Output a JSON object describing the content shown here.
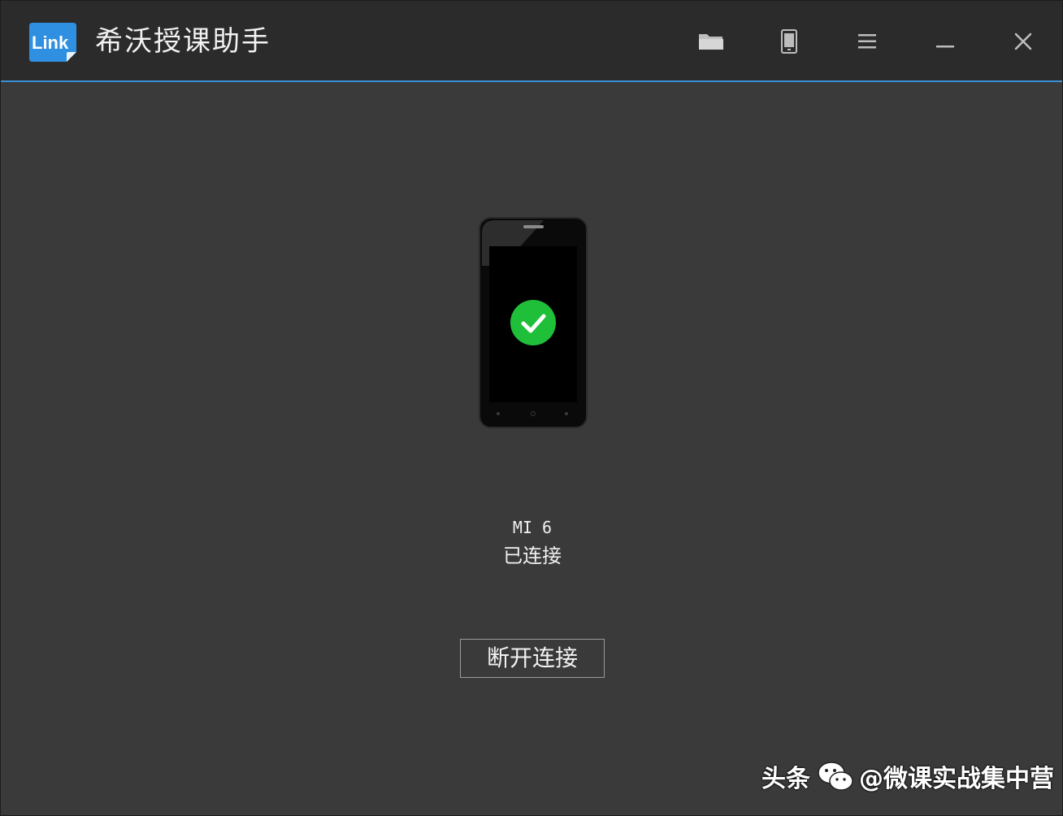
{
  "window": {
    "title": "希沃授课助手",
    "logo_text": "Link",
    "accent": "#3a8fd6"
  },
  "toolbar": {
    "icons": [
      "folder-icon",
      "phone-icon",
      "menu-icon",
      "minimize-icon",
      "close-icon"
    ]
  },
  "device": {
    "name": "MI 6",
    "status": "已连接",
    "status_icon": "check-icon",
    "status_color": "#1fbf3a"
  },
  "actions": {
    "disconnect_label": "断开连接"
  },
  "watermark": {
    "prefix": "头条",
    "handle": "@微课实战集中营"
  }
}
